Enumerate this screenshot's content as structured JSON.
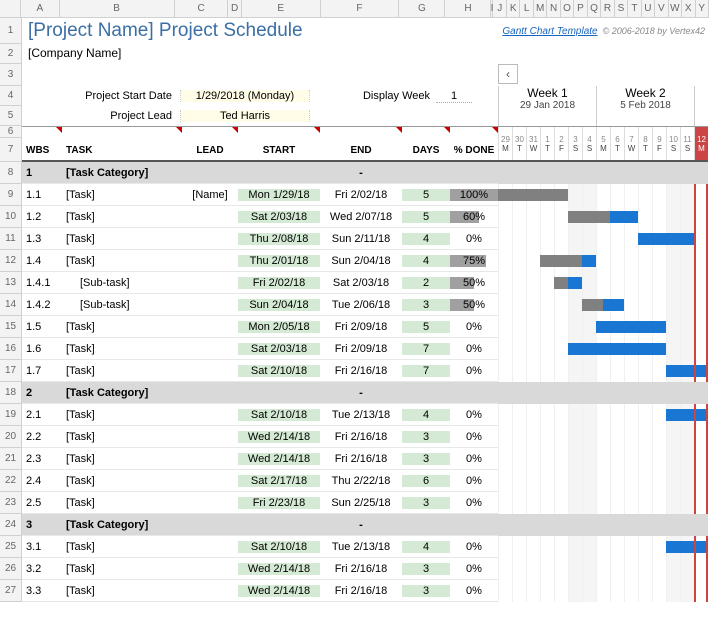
{
  "colHeaders": [
    "A",
    "B",
    "C",
    "D",
    "E",
    "F",
    "G",
    "H",
    "I",
    "J",
    "K",
    "L",
    "M",
    "N",
    "O",
    "P",
    "Q",
    "R",
    "S",
    "T",
    "U",
    "V",
    "W",
    "X",
    "Y"
  ],
  "title": "[Project Name] Project Schedule",
  "company": "[Company Name]",
  "templateLink": "Gantt Chart Template",
  "copyright": "© 2006-2018 by Vertex42",
  "projectStartLabel": "Project Start Date",
  "projectStartValue": "1/29/2018 (Monday)",
  "projectLeadLabel": "Project Lead",
  "projectLeadValue": "Ted Harris",
  "displayWeekLabel": "Display Week",
  "displayWeekValue": "1",
  "weeks": [
    {
      "label": "Week 1",
      "date": "29 Jan 2018"
    },
    {
      "label": "Week 2",
      "date": "5 Feb 2018"
    }
  ],
  "days": [
    {
      "n": "29",
      "l": "M"
    },
    {
      "n": "30",
      "l": "T"
    },
    {
      "n": "31",
      "l": "W"
    },
    {
      "n": "1",
      "l": "T"
    },
    {
      "n": "2",
      "l": "F"
    },
    {
      "n": "3",
      "l": "S"
    },
    {
      "n": "4",
      "l": "S"
    },
    {
      "n": "5",
      "l": "M"
    },
    {
      "n": "6",
      "l": "T"
    },
    {
      "n": "7",
      "l": "W"
    },
    {
      "n": "8",
      "l": "T"
    },
    {
      "n": "9",
      "l": "F"
    },
    {
      "n": "10",
      "l": "S"
    },
    {
      "n": "11",
      "l": "S"
    },
    {
      "n": "12",
      "l": "M"
    }
  ],
  "todayIndex": 14,
  "cols": {
    "wbs": "WBS",
    "task": "TASK",
    "lead": "LEAD",
    "start": "START",
    "end": "END",
    "days": "DAYS",
    "done": "% DONE"
  },
  "rows": [
    {
      "n": 8,
      "cat": true,
      "wbs": "1",
      "task": "[Task Category]",
      "end": "-"
    },
    {
      "n": 9,
      "wbs": "1.1",
      "task": "[Task]",
      "lead": "[Name]",
      "start": "Mon 1/29/18",
      "end": "Fri 2/02/18",
      "days": "5",
      "done": 100,
      "bars": [
        {
          "k": "gray",
          "s": 0,
          "w": 5
        }
      ]
    },
    {
      "n": 10,
      "wbs": "1.2",
      "task": "[Task]",
      "start": "Sat 2/03/18",
      "end": "Wed 2/07/18",
      "days": "5",
      "done": 60,
      "bars": [
        {
          "k": "gray",
          "s": 5,
          "w": 3
        },
        {
          "k": "blue",
          "s": 8,
          "w": 2
        }
      ]
    },
    {
      "n": 11,
      "wbs": "1.3",
      "task": "[Task]",
      "start": "Thu 2/08/18",
      "end": "Sun 2/11/18",
      "days": "4",
      "done": 0,
      "bars": [
        {
          "k": "blue",
          "s": 10,
          "w": 4
        }
      ]
    },
    {
      "n": 12,
      "wbs": "1.4",
      "task": "[Task]",
      "start": "Thu 2/01/18",
      "end": "Sun 2/04/18",
      "days": "4",
      "done": 75,
      "bars": [
        {
          "k": "gray",
          "s": 3,
          "w": 3
        },
        {
          "k": "blue",
          "s": 6,
          "w": 1
        }
      ]
    },
    {
      "n": 13,
      "wbs": "1.4.1",
      "task": "[Sub-task]",
      "sub": true,
      "start": "Fri 2/02/18",
      "end": "Sat 2/03/18",
      "days": "2",
      "done": 50,
      "bars": [
        {
          "k": "gray",
          "s": 4,
          "w": 1
        },
        {
          "k": "blue",
          "s": 5,
          "w": 1
        }
      ]
    },
    {
      "n": 14,
      "wbs": "1.4.2",
      "task": "[Sub-task]",
      "sub": true,
      "start": "Sun 2/04/18",
      "end": "Tue 2/06/18",
      "days": "3",
      "done": 50,
      "bars": [
        {
          "k": "gray",
          "s": 6,
          "w": 1.5
        },
        {
          "k": "blue",
          "s": 7.5,
          "w": 1.5
        }
      ]
    },
    {
      "n": 15,
      "wbs": "1.5",
      "task": "[Task]",
      "start": "Mon 2/05/18",
      "end": "Fri 2/09/18",
      "days": "5",
      "done": 0,
      "bars": [
        {
          "k": "blue",
          "s": 7,
          "w": 5
        }
      ]
    },
    {
      "n": 16,
      "wbs": "1.6",
      "task": "[Task]",
      "start": "Sat 2/03/18",
      "end": "Fri 2/09/18",
      "days": "7",
      "done": 0,
      "bars": [
        {
          "k": "blue",
          "s": 5,
          "w": 7
        }
      ]
    },
    {
      "n": 17,
      "wbs": "1.7",
      "task": "[Task]",
      "start": "Sat 2/10/18",
      "end": "Fri 2/16/18",
      "days": "7",
      "done": 0,
      "bars": [
        {
          "k": "blue",
          "s": 12,
          "w": 3
        }
      ]
    },
    {
      "n": 18,
      "cat": true,
      "wbs": "2",
      "task": "[Task Category]",
      "end": "-"
    },
    {
      "n": 19,
      "wbs": "2.1",
      "task": "[Task]",
      "start": "Sat 2/10/18",
      "end": "Tue 2/13/18",
      "days": "4",
      "done": 0,
      "bars": [
        {
          "k": "blue",
          "s": 12,
          "w": 3
        }
      ]
    },
    {
      "n": 20,
      "wbs": "2.2",
      "task": "[Task]",
      "start": "Wed 2/14/18",
      "end": "Fri 2/16/18",
      "days": "3",
      "done": 0,
      "bars": []
    },
    {
      "n": 21,
      "wbs": "2.3",
      "task": "[Task]",
      "start": "Wed 2/14/18",
      "end": "Fri 2/16/18",
      "days": "3",
      "done": 0,
      "bars": []
    },
    {
      "n": 22,
      "wbs": "2.4",
      "task": "[Task]",
      "start": "Sat 2/17/18",
      "end": "Thu 2/22/18",
      "days": "6",
      "done": 0,
      "bars": []
    },
    {
      "n": 23,
      "wbs": "2.5",
      "task": "[Task]",
      "start": "Fri 2/23/18",
      "end": "Sun 2/25/18",
      "days": "3",
      "done": 0,
      "bars": []
    },
    {
      "n": 24,
      "cat": true,
      "wbs": "3",
      "task": "[Task Category]",
      "end": "-"
    },
    {
      "n": 25,
      "wbs": "3.1",
      "task": "[Task]",
      "start": "Sat 2/10/18",
      "end": "Tue 2/13/18",
      "days": "4",
      "done": 0,
      "bars": [
        {
          "k": "blue",
          "s": 12,
          "w": 3
        }
      ]
    },
    {
      "n": 26,
      "wbs": "3.2",
      "task": "[Task]",
      "start": "Wed 2/14/18",
      "end": "Fri 2/16/18",
      "days": "3",
      "done": 0,
      "bars": []
    },
    {
      "n": 27,
      "wbs": "3.3",
      "task": "[Task]",
      "start": "Wed 2/14/18",
      "end": "Fri 2/16/18",
      "days": "3",
      "done": 0,
      "bars": []
    }
  ]
}
